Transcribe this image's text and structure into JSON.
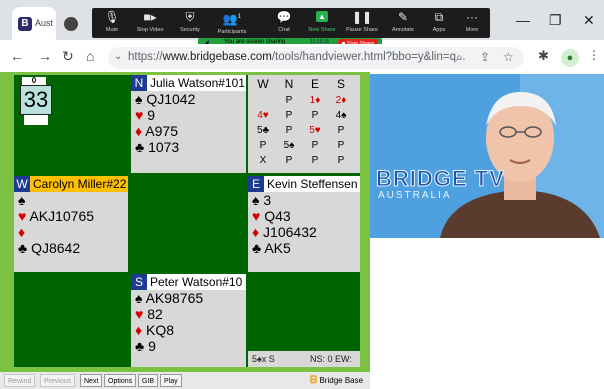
{
  "browser": {
    "tab_label": "Aust",
    "favicon_letter": "B",
    "url_prefix": "https://",
    "url_host": "www.bridgebase.com",
    "url_rest": "/tools/handviewer.html?bbo=y&lin=q..."
  },
  "zoom_toolbar": {
    "items": [
      {
        "label": "Mute",
        "icon": "microphone-icon"
      },
      {
        "label": "Stop Video",
        "icon": "video-camera-icon"
      },
      {
        "label": "Security",
        "icon": "shield-icon"
      },
      {
        "label": "Participants",
        "icon": "participants-icon",
        "count": "1"
      },
      {
        "label": "Chat",
        "icon": "chat-icon"
      },
      {
        "label": "New Share",
        "icon": "share-icon"
      },
      {
        "label": "Pause Share",
        "icon": "pause-icon"
      },
      {
        "label": "Annotate",
        "icon": "pencil-icon"
      },
      {
        "label": "Apps",
        "icon": "apps-icon"
      },
      {
        "label": "More",
        "icon": "more-icon"
      }
    ],
    "sharing_text": "You are screen sharing",
    "share_timer": "10:15:35",
    "stop_share_label": "■ Stop Share"
  },
  "tricks": {
    "caption": "0",
    "value": "33"
  },
  "hands": {
    "north": {
      "seat": "N",
      "player": "Julia Watson#101",
      "spades": "QJ1042",
      "hearts": "9",
      "diamonds": "A975",
      "clubs": "1073"
    },
    "west": {
      "seat": "W",
      "player": "Carolyn Miller#22",
      "spades": "",
      "hearts": "AKJ10765",
      "diamonds": "",
      "clubs": "QJ8642"
    },
    "east": {
      "seat": "E",
      "player": "Kevin Steffensen",
      "spades": "3",
      "hearts": "Q43",
      "diamonds": "J106432",
      "clubs": "AK5"
    },
    "south": {
      "seat": "S",
      "player": "Peter Watson#10",
      "spades": "AK98765",
      "hearts": "82",
      "diamonds": "KQ8",
      "clubs": "9"
    }
  },
  "suits": {
    "spade": "♠",
    "heart": "♥",
    "diamond": "♦",
    "club": "♣"
  },
  "bidding": {
    "headers": [
      "W",
      "N",
      "E",
      "S"
    ],
    "rows": [
      [
        "",
        "P",
        "1♦",
        "2♦"
      ],
      [
        "4♥",
        "P",
        "P",
        "4♠"
      ],
      [
        "5♣",
        "P",
        "5♥",
        "P"
      ],
      [
        "P",
        "5♠",
        "P",
        "P"
      ],
      [
        "X",
        "P",
        "P",
        "P"
      ]
    ]
  },
  "contract": {
    "text": "5♠x S",
    "score": "NS: 0 EW:"
  },
  "controls": {
    "rewind": "Rewind",
    "previous": "Previous",
    "next": "Next",
    "options": "Options",
    "gib": "GIB",
    "play": "Play",
    "brand": "Bridge Base"
  },
  "video": {
    "title": "BRIDGE TV",
    "subtitle": "AUSTRALIA"
  }
}
